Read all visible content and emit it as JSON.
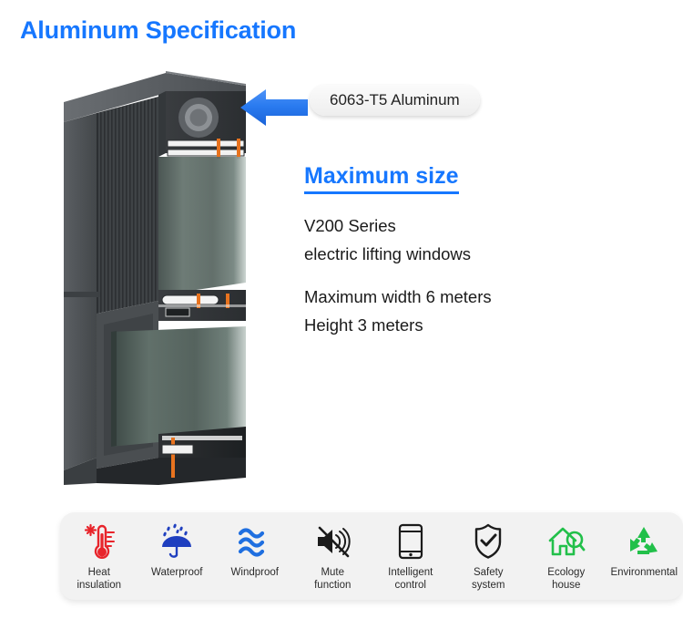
{
  "title": "Aluminum Specification",
  "accent_color": "#1677ff",
  "callout": {
    "label": "6063-T5 Aluminum",
    "arrow_icon": "left-arrow-icon",
    "arrow_color": "#2a7bf0"
  },
  "product": {
    "image_name": "aluminum-window-profile-cutaway",
    "frame_color": "#4b4e51",
    "glass_color": "#5c6a64"
  },
  "spec": {
    "heading": "Maximum size",
    "group_one": [
      "V200 Series",
      "electric lifting windows"
    ],
    "group_two": [
      "Maximum width 6 meters",
      "Height 3 meters"
    ]
  },
  "features": [
    {
      "icon": "thermometer-icon",
      "label": "Heat\ninsulation",
      "color": "#e8242b"
    },
    {
      "icon": "umbrella-rain-icon",
      "label": "Waterproof",
      "color": "#1f3fbf"
    },
    {
      "icon": "wind-waves-icon",
      "label": "Windproof",
      "color": "#1f6fe0"
    },
    {
      "icon": "speaker-mute-icon",
      "label": "Mute\nfunction",
      "color": "#1b1b1b"
    },
    {
      "icon": "tablet-icon",
      "label": "Intelligent\ncontrol",
      "color": "#1b1b1b"
    },
    {
      "icon": "shield-check-icon",
      "label": "Safety\nsystem",
      "color": "#1b1b1b"
    },
    {
      "icon": "house-search-icon",
      "label": "Ecology\nhouse",
      "color": "#22c04a"
    },
    {
      "icon": "recycle-icon",
      "label": "Environmental",
      "color": "#22c04a"
    }
  ]
}
